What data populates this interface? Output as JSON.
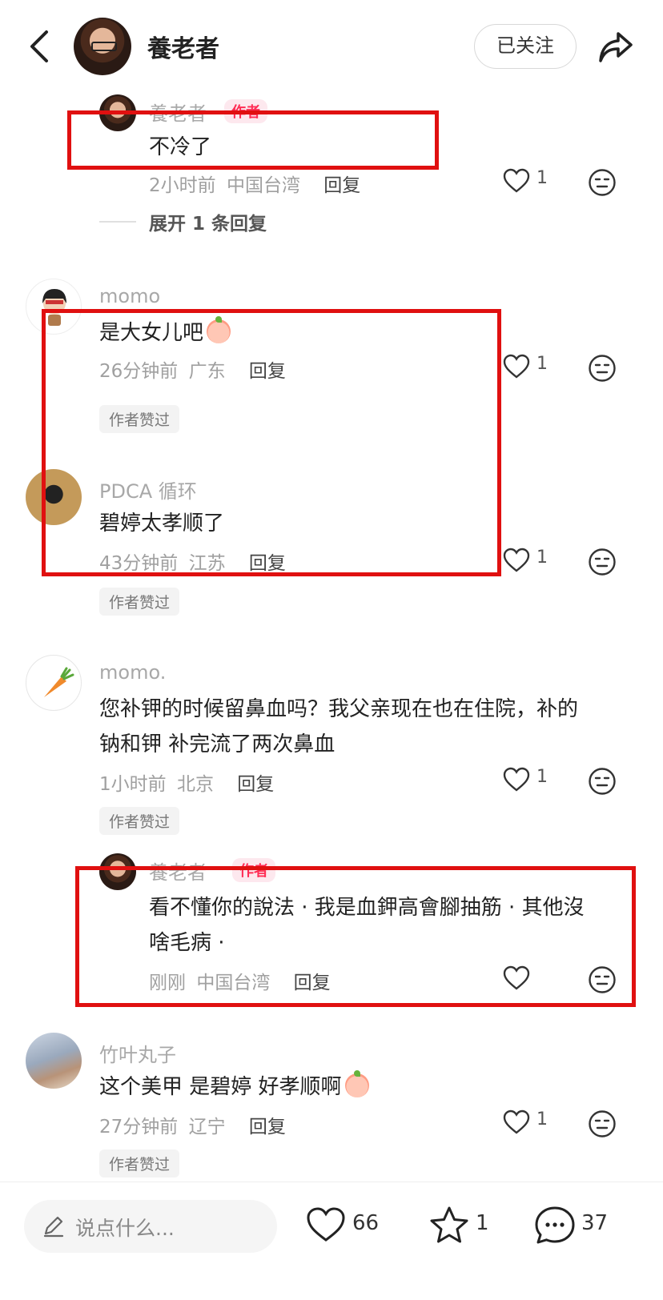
{
  "header": {
    "title": "養老者",
    "follow_label": "已关注",
    "icons": {
      "back": "chevron-left-icon",
      "share": "share-arrow-icon"
    }
  },
  "comments": [
    {
      "user": "養老者",
      "badge": "作者",
      "text": "不冷了",
      "time": "2小时前",
      "location": "中国台湾",
      "reply_label": "回复",
      "likes": "1",
      "expand_label": "展开 1 条回复"
    },
    {
      "user": "momo",
      "text": "是大女儿吧",
      "time": "26分钟前",
      "location": "广东",
      "reply_label": "回复",
      "likes": "1",
      "liked_tag": "作者赞过"
    },
    {
      "user": "PDCA 循环",
      "text": "碧婷太孝顺了",
      "time": "43分钟前",
      "location": "江苏",
      "reply_label": "回复",
      "likes": "1",
      "liked_tag": "作者赞过"
    },
    {
      "user": "momo.",
      "text_line1": "您补钾的时候留鼻血吗？我父亲现在也在住院，补的",
      "text_line2": "钠和钾 补完流了两次鼻血",
      "time": "1小时前",
      "location": "北京",
      "reply_label": "回复",
      "likes": "1",
      "liked_tag": "作者赞过"
    },
    {
      "user": "養老者",
      "badge": "作者",
      "text_line1": "看不懂你的說法 · 我是血鉀高會腳抽筋 · 其他沒",
      "text_line2": "啥毛病 ·",
      "time": "刚刚",
      "location": "中国台湾",
      "reply_label": "回复"
    },
    {
      "user": "竹叶丸子",
      "text": "这个美甲 是碧婷 好孝顺啊",
      "time": "27分钟前",
      "location": "辽宁",
      "reply_label": "回复",
      "likes": "1",
      "liked_tag": "作者赞过"
    }
  ],
  "bottom_bar": {
    "placeholder": "说点什么...",
    "likes": "66",
    "stars": "1",
    "comments": "37"
  },
  "colors": {
    "highlight_box": "#e01010",
    "author_badge": "#ff2d55"
  }
}
